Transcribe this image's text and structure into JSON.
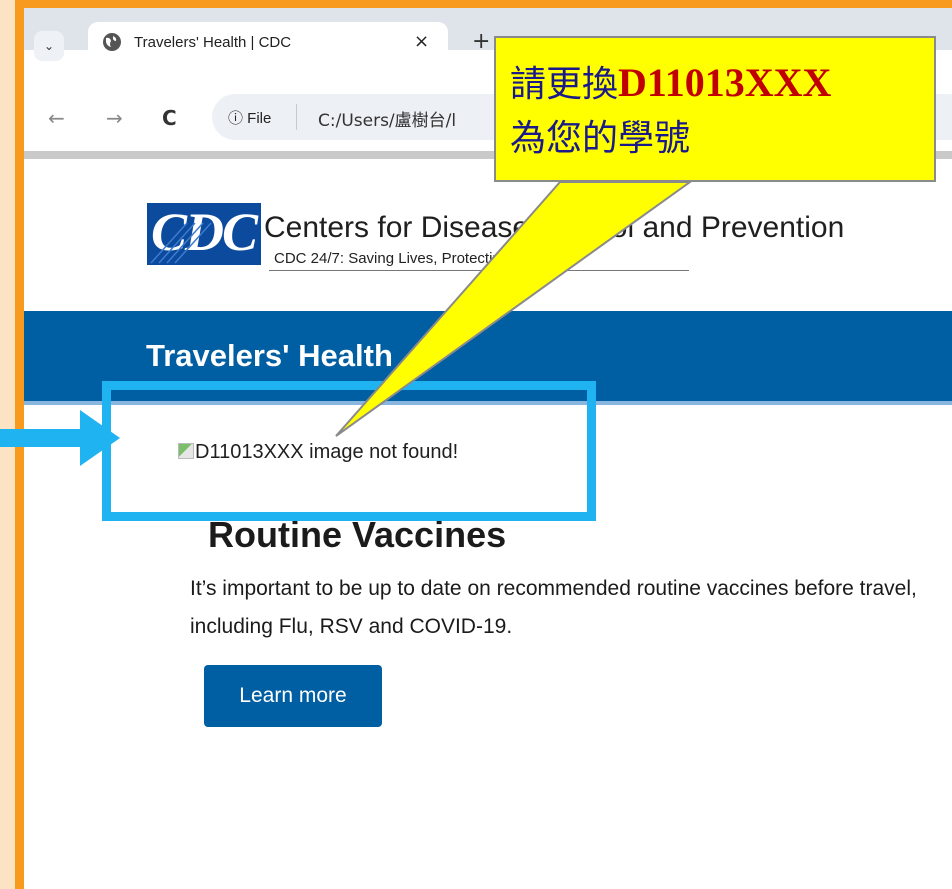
{
  "browser": {
    "tab_title": "Travelers' Health | CDC",
    "tab_close": "×",
    "new_tab": "+",
    "dropdown": "⌄",
    "back": "←",
    "forward": "→",
    "reload": "C",
    "info_label": "ⓘ File",
    "url": "C:/Users/盧樹台/l"
  },
  "header": {
    "logo_text": "CDC",
    "org_name": "Centers for Disease Control and Prevention",
    "tagline": "CDC 24/7: Saving Lives, Protecting People™"
  },
  "banner": {
    "title": "Travelers' Health"
  },
  "broken_image": {
    "alt": "D11013XXX image not found!"
  },
  "section": {
    "title": "Routine Vaccines",
    "body": "It’s important to be up to date on recommended routine vaccines before travel, including Flu, RSV and COVID-19.",
    "button": "Learn more"
  },
  "callout": {
    "prefix": "請更換",
    "code": "D11013XXX",
    "line2": "為您的學號"
  },
  "colors": {
    "frame": "#f79a1e",
    "cdc_blue": "#005ea2",
    "highlight": "#1fb3f1",
    "callout_bg": "#ffff00"
  }
}
